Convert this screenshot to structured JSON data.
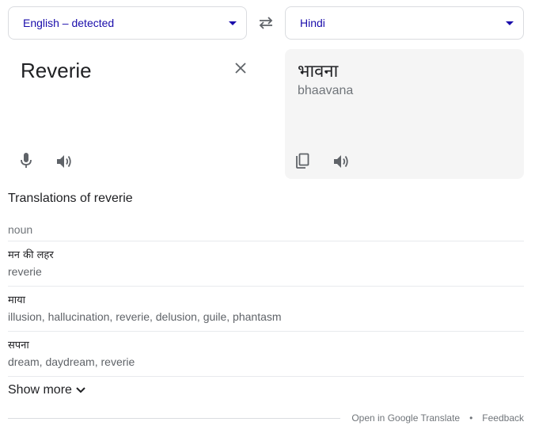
{
  "source_language": {
    "label": "English – detected"
  },
  "target_language": {
    "label": "Hindi"
  },
  "source": {
    "text": "Reverie"
  },
  "translation": {
    "text": "भावना",
    "transliteration": "bhaavana"
  },
  "dictionary": {
    "title": "Translations of reverie",
    "part_of_speech": "noun",
    "entries": [
      {
        "word": "मन की लहर",
        "synonyms": "reverie"
      },
      {
        "word": "माया",
        "synonyms": "illusion, hallucination, reverie, delusion, guile, phantasm"
      },
      {
        "word": "सपना",
        "synonyms": "dream, daydream, reverie"
      }
    ],
    "show_more": "Show more"
  },
  "footer": {
    "open_link": "Open in Google Translate",
    "separator": "•",
    "feedback": "Feedback"
  },
  "icons": {
    "swap": "swap-arrows-icon",
    "clear": "close-icon",
    "mic": "microphone-icon",
    "listen": "speaker-icon",
    "copy": "copy-icon",
    "expand": "chevron-down-icon"
  },
  "colors": {
    "link": "#1a0dab",
    "muted": "#70757a",
    "panel": "#f5f5f5"
  }
}
